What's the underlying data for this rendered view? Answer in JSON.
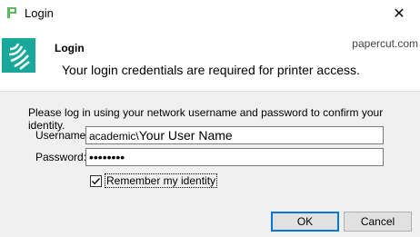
{
  "window": {
    "title": "Login",
    "close_label": "✕"
  },
  "header": {
    "title": "Login",
    "message": "Your login credentials are required for printer access.",
    "brand": "papercut.com"
  },
  "form": {
    "instructions": "Please log in using your network username and password to confirm your identity.",
    "username_label": "Username:",
    "username_prefix": "academic\\",
    "username_value": "Your User Name",
    "password_label": "Password:",
    "password_value": "••••••••",
    "remember_label": "Remember my identity",
    "remember_checked": true
  },
  "buttons": {
    "ok": "OK",
    "cancel": "Cancel"
  },
  "colors": {
    "accent": "#0078d7",
    "logo": "#17a89a",
    "app_icon": "#5cb85c"
  }
}
